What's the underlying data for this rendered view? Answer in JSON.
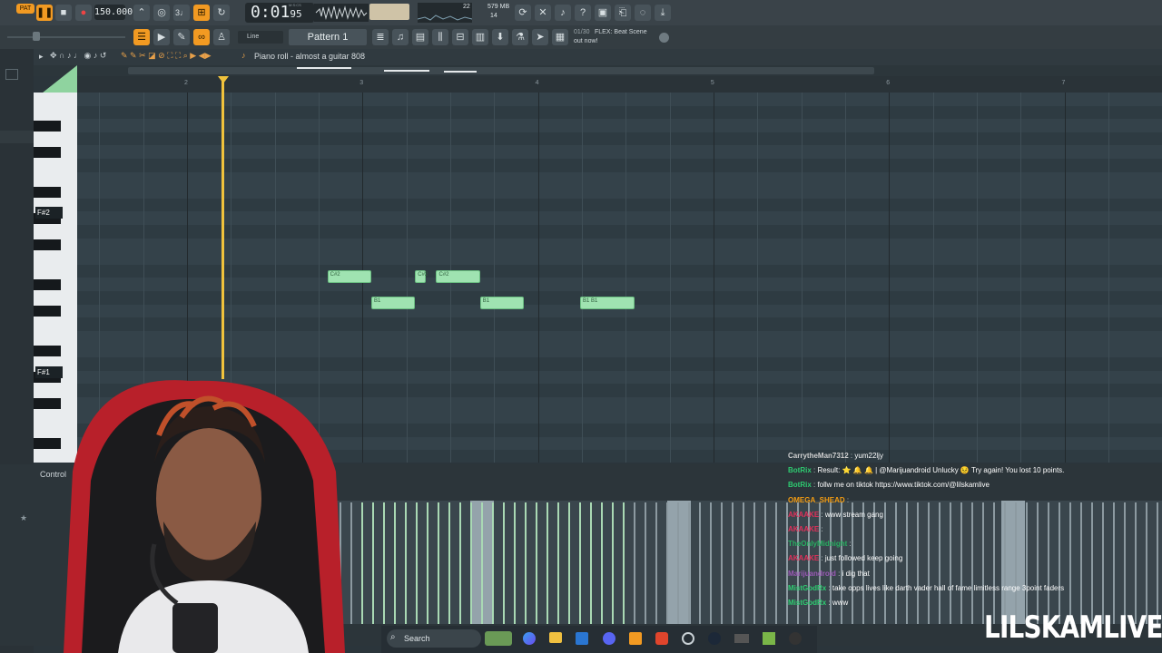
{
  "toolbar": {
    "pat_label": "PAT",
    "tempo": "150.000",
    "time_display": "0:01",
    "time_ms": "95",
    "msc_label": "M:S:CS",
    "cpu_value": "22",
    "voices_value": "14",
    "memory": "579 MB",
    "snap_label": "Line",
    "pattern_label": "Pattern 1",
    "news_counter": "01/30",
    "news_text": "FLEX: Beat Scene",
    "news_subtext": "out now!"
  },
  "piano_roll": {
    "title": "Piano roll - almost a guitar 808",
    "ruler_numbers": [
      "2",
      "3",
      "4",
      "5",
      "6",
      "7"
    ],
    "key_labels": [
      "F#2",
      "F#1"
    ],
    "notes": [
      {
        "label": "C#2",
        "pitch": "C#2",
        "start": 2.8,
        "length": 0.25
      },
      {
        "label": "C#2",
        "pitch": "C#2",
        "start": 3.3,
        "length": 0.06
      },
      {
        "label": "C#2",
        "pitch": "C#2",
        "start": 3.42,
        "length": 0.25
      },
      {
        "label": "B1",
        "pitch": "B1",
        "start": 3.05,
        "length": 0.25
      },
      {
        "label": "B1",
        "pitch": "B1",
        "start": 3.67,
        "length": 0.25
      },
      {
        "label": "B1 B1",
        "pitch": "B1",
        "start": 4.24,
        "length": 0.31
      }
    ]
  },
  "control": {
    "label": "Control"
  },
  "chat": {
    "lines": [
      {
        "user": "CarrytheMan7312",
        "text": "yum22ljy",
        "color": "#d0d0d0"
      },
      {
        "user": "BotRix",
        "text": "Result: ⭐ 🔔 🔔 | @Marijuandroid Unlucky 😣 Try again! You lost 10 points.",
        "color": "#2ecc71"
      },
      {
        "user": "BotRix",
        "text": "follw me on tiktok https://www.tiktok.com/@lilskamlive",
        "color": "#2ecc71"
      },
      {
        "user": "OMEGA_SHEAD",
        "text": "",
        "color": "#f39c12"
      },
      {
        "user": "AKAAKE",
        "text": "www stream gang",
        "color": "#e0305a"
      },
      {
        "user": "AKAAKE",
        "text": "",
        "color": "#e0305a"
      },
      {
        "user": "TheOnlyMidnight",
        "text": "",
        "color": "#27ae60"
      },
      {
        "user": "AKAAKE",
        "text": "just followed keep going",
        "color": "#e0305a"
      },
      {
        "user": "Marijuandroid",
        "text": "i dig that",
        "color": "#9b59b6"
      },
      {
        "user": "MistGodRx",
        "text": "take opps lives like darth vader hall of fame limitless range 3point faders",
        "color": "#2ecc71"
      },
      {
        "user": "MistGodRx",
        "text": "www",
        "color": "#2ecc71"
      }
    ]
  },
  "taskbar": {
    "search_label": "Search"
  },
  "watermark": "LILSKAMLIVE",
  "colors": {
    "accent": "#f29a22",
    "note_fill": "#9fe3b1",
    "playhead": "#f0c23c",
    "grid_bg": "#34424a"
  }
}
